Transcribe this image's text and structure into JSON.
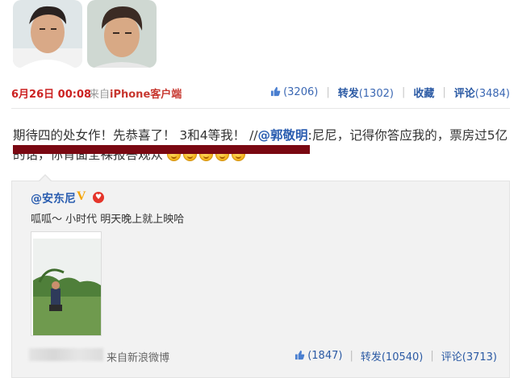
{
  "post": {
    "time": "6月26日 00:08",
    "from_prefix": "来自",
    "client": "iPhone客户端",
    "actions": {
      "like_count": "(3206)",
      "repost_label": "转发",
      "repost_count": "(1302)",
      "favorite_label": "收藏",
      "comment_label": "评论",
      "comment_count": "(3484)"
    },
    "text_part1": "期待四的处女作！先恭喜了！ 3和4等我！ //",
    "mention": "@郭敬明",
    "text_part2": ":尼尼，记得你答应我的，票房过5亿的话，你背面全裸报答观众"
  },
  "quoted": {
    "author": "@安东尼",
    "vbadge": "V",
    "text": "呱呱～ 小时代 明天晚上就上映哈",
    "from": "来自新浪微博",
    "like_count": "(1847)",
    "repost_label": "转发",
    "repost_count": "(10540)",
    "comment_label": "评论",
    "comment_count": "(3713)"
  },
  "colors": {
    "time_red": "#cc2222",
    "link_blue": "#2a5db0",
    "redaction": "#7a0812",
    "quote_bg": "#f2f2f2"
  },
  "icons": {
    "like": "thumbs-up-icon",
    "emoji": "crying-face-icon",
    "heart": "heart-icon"
  }
}
